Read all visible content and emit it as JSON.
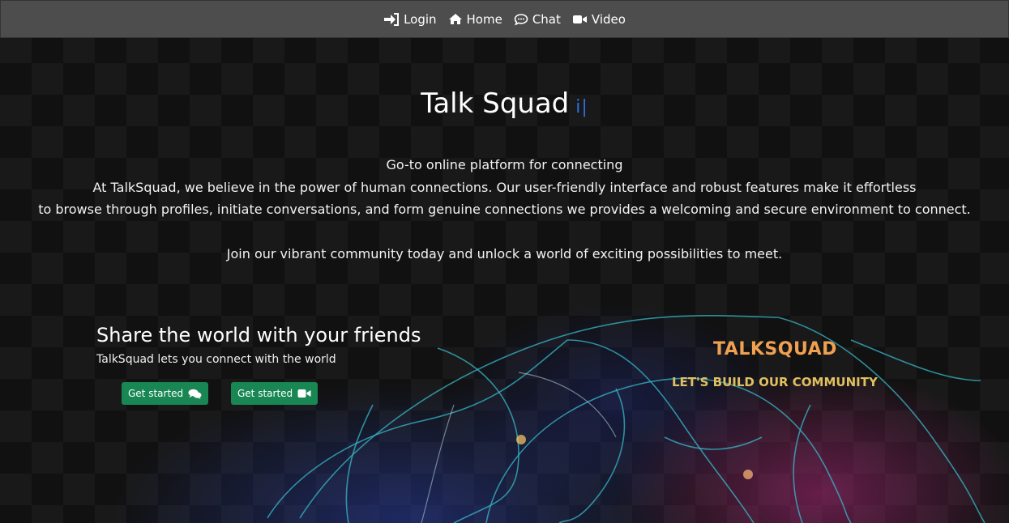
{
  "nav": {
    "items": [
      {
        "label": "Login",
        "icon": "login-icon"
      },
      {
        "label": "Home",
        "icon": "home-icon"
      },
      {
        "label": "Chat",
        "icon": "chat-icon"
      },
      {
        "label": "Video",
        "icon": "video-icon"
      }
    ]
  },
  "hero": {
    "title": "Talk Squad",
    "typing_cursor": "i|",
    "lines": [
      "Go-to online platform for connecting",
      "At TalkSquad, we believe in the power of human connections. Our user-friendly interface and robust features make it effortless",
      "to browse through profiles, initiate conversations, and form genuine connections we provides a welcoming and secure environment to connect."
    ],
    "join": "Join our vibrant community today and unlock a world of exciting possibilities to meet."
  },
  "share": {
    "heading": "Share the world with your friends",
    "subheading": "TalkSquad lets you connect with the world",
    "buttons": [
      {
        "label": "Get started",
        "icon": "chat-bubbles-icon"
      },
      {
        "label": "Get started",
        "icon": "video-icon"
      }
    ]
  },
  "brand": {
    "name": "TALKSQUAD",
    "tagline": "LET'S BUILD OUR COMMUNITY"
  },
  "colors": {
    "nav_bg": "#4d4d4d",
    "button_bg": "#198754",
    "cursor": "#2c6fe0"
  }
}
